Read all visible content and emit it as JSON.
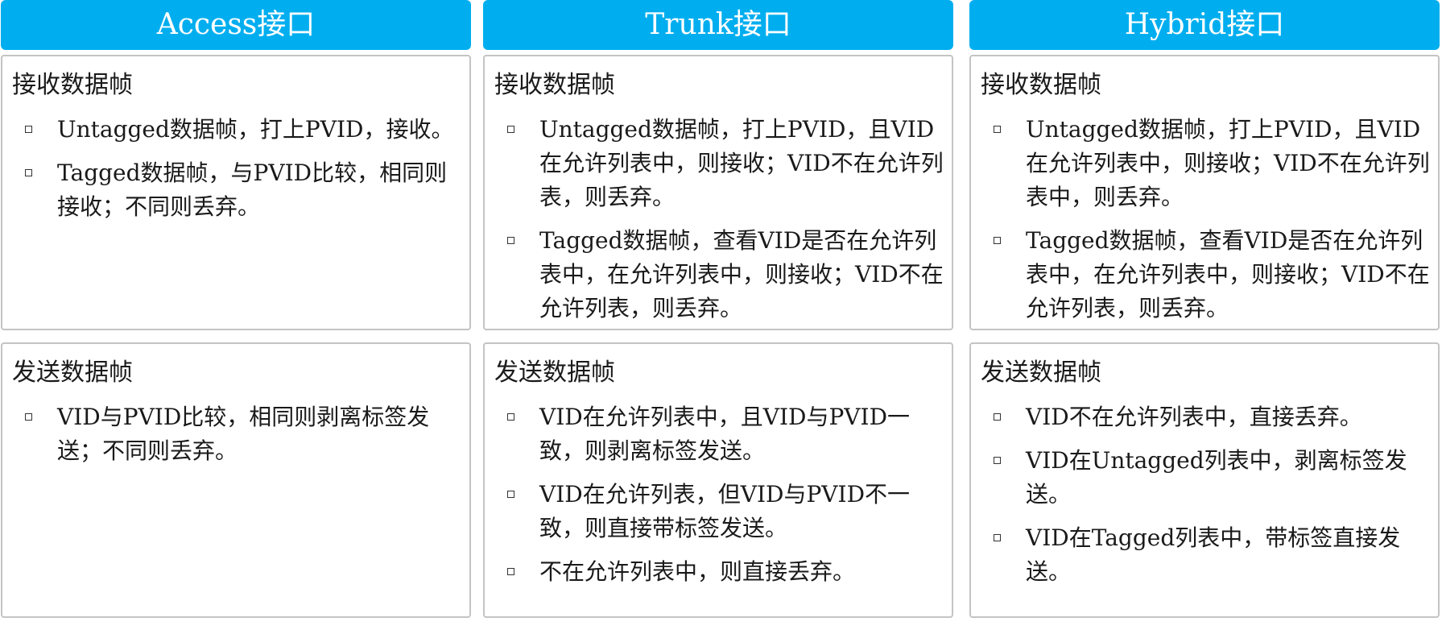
{
  "columns": [
    {
      "header": "Access接口",
      "receive": {
        "title": "接收数据帧",
        "items": [
          "Untagged数据帧，打上PVID，接收。",
          "Tagged数据帧，与PVID比较，相同则接收；不同则丢弃。"
        ]
      },
      "send": {
        "title": "发送数据帧",
        "items": [
          "VID与PVID比较，相同则剥离标签发送；不同则丢弃。"
        ]
      }
    },
    {
      "header": "Trunk接口",
      "receive": {
        "title": "接收数据帧",
        "items": [
          "Untagged数据帧，打上PVID，且VID在允许列表中，则接收；VID不在允许列表，则丢弃。",
          "Tagged数据帧，查看VID是否在允许列表中，在允许列表中，则接收；VID不在允许列表，则丢弃。"
        ]
      },
      "send": {
        "title": "发送数据帧",
        "items": [
          "VID在允许列表中，且VID与PVID一致，则剥离标签发送。",
          "VID在允许列表，但VID与PVID不一致，则直接带标签发送。",
          "不在允许列表中，则直接丢弃。"
        ]
      }
    },
    {
      "header": "Hybrid接口",
      "receive": {
        "title": "接收数据帧",
        "items": [
          "Untagged数据帧，打上PVID，且VID在允许列表中，则接收；VID不在允许列表中，则丢弃。",
          "Tagged数据帧，查看VID是否在允许列表中，在允许列表中，则接收；VID不在允许列表，则丢弃。"
        ]
      },
      "send": {
        "title": "发送数据帧",
        "items": [
          "VID不在允许列表中，直接丢弃。",
          "VID在Untagged列表中，剥离标签发送。",
          "VID在Tagged列表中，带标签直接发送。"
        ]
      }
    }
  ]
}
